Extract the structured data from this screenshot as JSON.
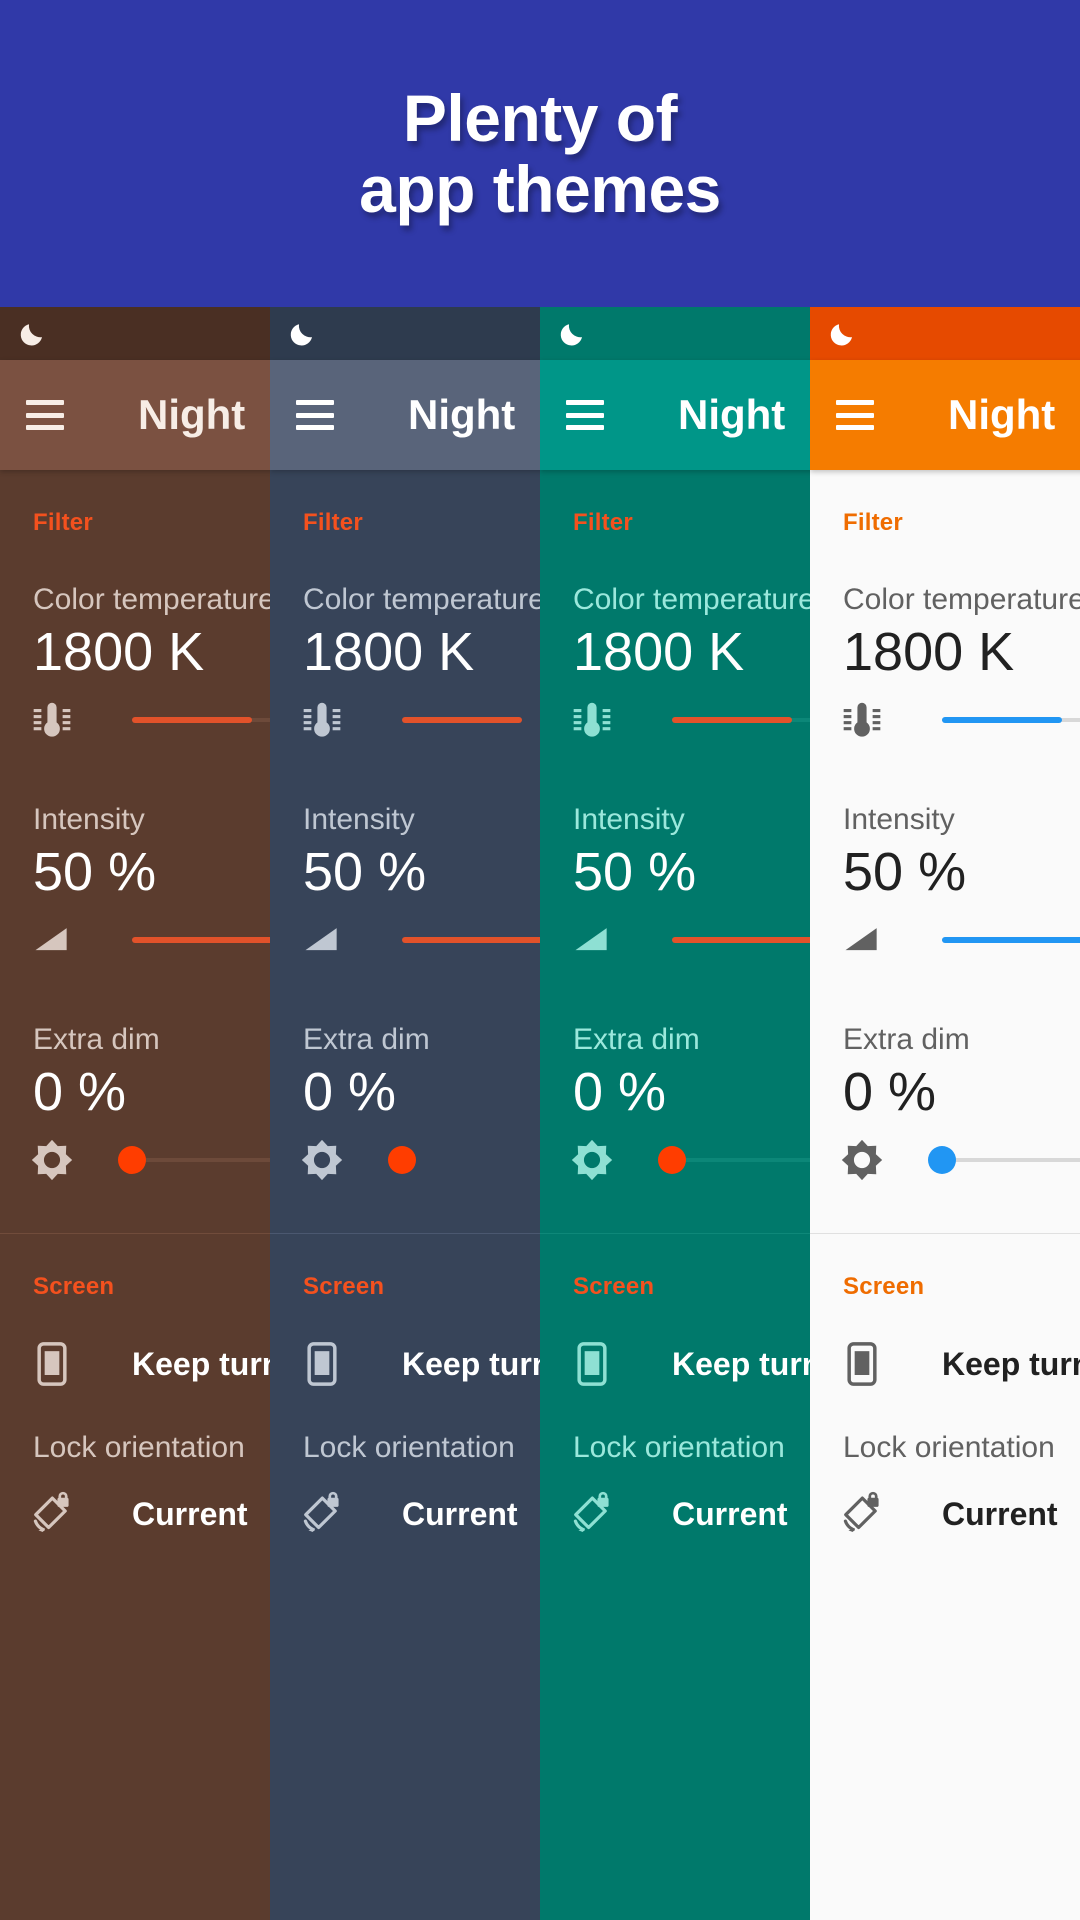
{
  "banner": {
    "title": "Plenty of\napp themes",
    "bg_color": "#3039A8",
    "text_color": "#FFFFFF"
  },
  "app": {
    "title": "Night",
    "status_icon": "moon-icon",
    "menu_icon": "hamburger-menu-icon"
  },
  "sections": {
    "filter_header": "Filter",
    "screen_header": "Screen"
  },
  "settings": {
    "color_temperature": {
      "label": "Color temperature",
      "value": "1800 K",
      "icon": "thermometer-icon",
      "slider_percent": 18
    },
    "intensity": {
      "label": "Intensity",
      "value": "50 %",
      "icon": "intensity-triangle-icon",
      "slider_percent": 50
    },
    "extra_dim": {
      "label": "Extra dim",
      "value": "0 %",
      "icon": "brightness-sun-icon",
      "slider_percent": 0
    }
  },
  "screen_options": {
    "keep_turned_on": {
      "label": "Keep turned on",
      "icon": "phone-icon"
    },
    "lock_orientation": {
      "label": "Lock orientation",
      "value": "Current",
      "icon": "rotation-lock-icon"
    }
  },
  "themes": [
    {
      "name": "brown-theme",
      "statusbar": "#4A2F23",
      "appbar": "#7B5141",
      "appbar_text": "#F7EDE6",
      "content_bg": "#5B3C2E",
      "accent": "#F4511E",
      "label_color": "#D6C6BE",
      "value_color": "#FFFFFF",
      "primary_text": "#FFFFFF",
      "icon_color": "#D6C6BE",
      "track_bg": "#6D4A3A",
      "track_fill": "#E2522A",
      "thumb": "#FF3D00",
      "divider": "#714C3B",
      "section_color": "#F4511E"
    },
    {
      "name": "slate-theme",
      "statusbar": "#2E3B4E",
      "appbar": "#59647A",
      "appbar_text": "#FFFFFF",
      "content_bg": "#374459",
      "accent": "#F4511E",
      "label_color": "#BFC7D2",
      "value_color": "#FFFFFF",
      "primary_text": "#FFFFFF",
      "icon_color": "#BFC7D2",
      "track_bg": "#4A５６6C",
      "track_fill": "#E2522A",
      "thumb": "#FF3D00",
      "divider": "#4B5870",
      "section_color": "#F4511E"
    },
    {
      "name": "teal-theme",
      "statusbar": "#00796B",
      "appbar": "#009688",
      "appbar_text": "#FFFFFF",
      "content_bg": "#00796B",
      "accent": "#F4511E",
      "label_color": "#9BE8DC",
      "value_color": "#FFFFFF",
      "primary_text": "#FFFFFF",
      "icon_color": "#8EE0D3",
      "track_bg": "#0C8778",
      "track_fill": "#E2522A",
      "thumb": "#FF3D00",
      "divider": "#0E8879",
      "section_color": "#F4511E"
    },
    {
      "name": "light-orange-theme",
      "statusbar": "#E64A00",
      "appbar": "#F57C00",
      "appbar_text": "#FFFFFF",
      "content_bg": "#FAFAFA",
      "accent": "#EF6C00",
      "label_color": "#616161",
      "value_color": "#212121",
      "primary_text": "#212121",
      "icon_color": "#616161",
      "track_bg": "#D8D8D8",
      "track_fill": "#2196F3",
      "thumb": "#2196F3",
      "divider": "#E0E0E0",
      "section_color": "#EF6C00"
    }
  ]
}
